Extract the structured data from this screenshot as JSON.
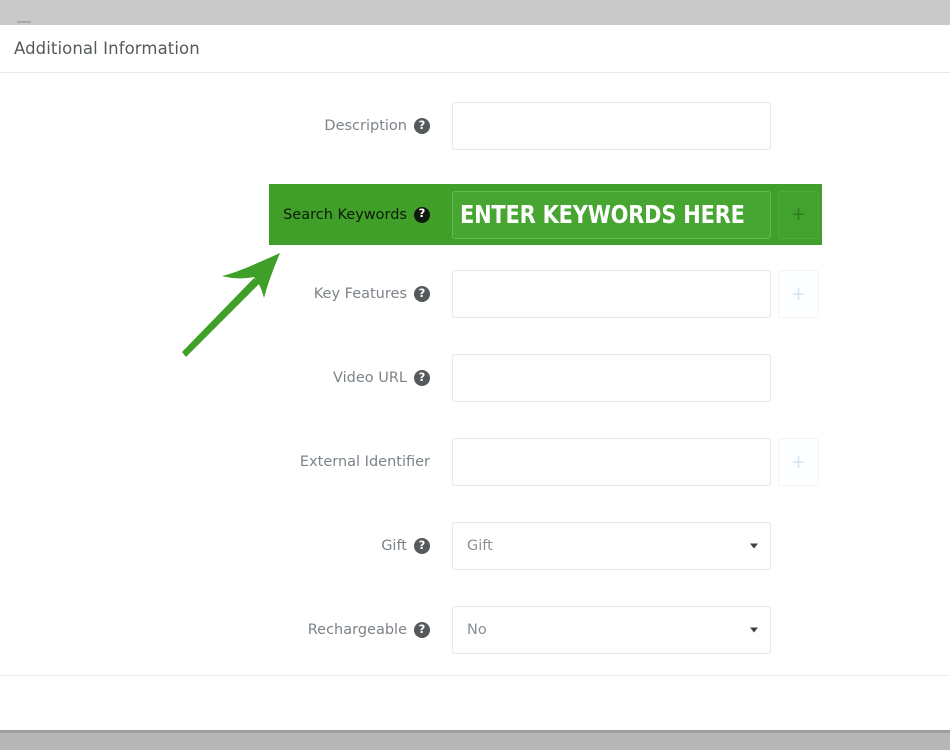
{
  "window": {
    "top_chrome_color": "#c9c9c9",
    "bottom_chrome_color": "#b6b6b6"
  },
  "card": {
    "title": "Additional Information"
  },
  "annotation": {
    "type": "arrow",
    "color": "#3f9f28",
    "points_to": "Search Keywords field",
    "highlight_color": "#3f9f28",
    "callout_text": "ENTER KEYWORDS HERE"
  },
  "form": {
    "help_icon_glyph": "?",
    "plus_icon_glyph": "+",
    "rows": [
      {
        "label": "Description",
        "help": true,
        "control": "text",
        "value": "",
        "placeholder": "",
        "plus_button": false,
        "highlighted": false
      },
      {
        "label": "Search Keywords",
        "help": true,
        "control": "text",
        "value": "ENTER KEYWORDS HERE",
        "placeholder": "",
        "plus_button": true,
        "highlighted": true
      },
      {
        "label": "Key Features",
        "help": true,
        "control": "text",
        "value": "",
        "placeholder": "",
        "plus_button": true,
        "highlighted": false
      },
      {
        "label": "Video URL",
        "help": true,
        "control": "text",
        "value": "",
        "placeholder": "",
        "plus_button": false,
        "highlighted": false
      },
      {
        "label": "External Identifier",
        "help": false,
        "control": "text",
        "value": "",
        "placeholder": "",
        "plus_button": true,
        "highlighted": false
      },
      {
        "label": "Gift",
        "help": true,
        "control": "select",
        "value": "Gift",
        "placeholder": "",
        "plus_button": false,
        "highlighted": false
      },
      {
        "label": "Rechargeable",
        "help": true,
        "control": "select",
        "value": "No",
        "placeholder": "",
        "plus_button": false,
        "highlighted": false
      }
    ]
  }
}
